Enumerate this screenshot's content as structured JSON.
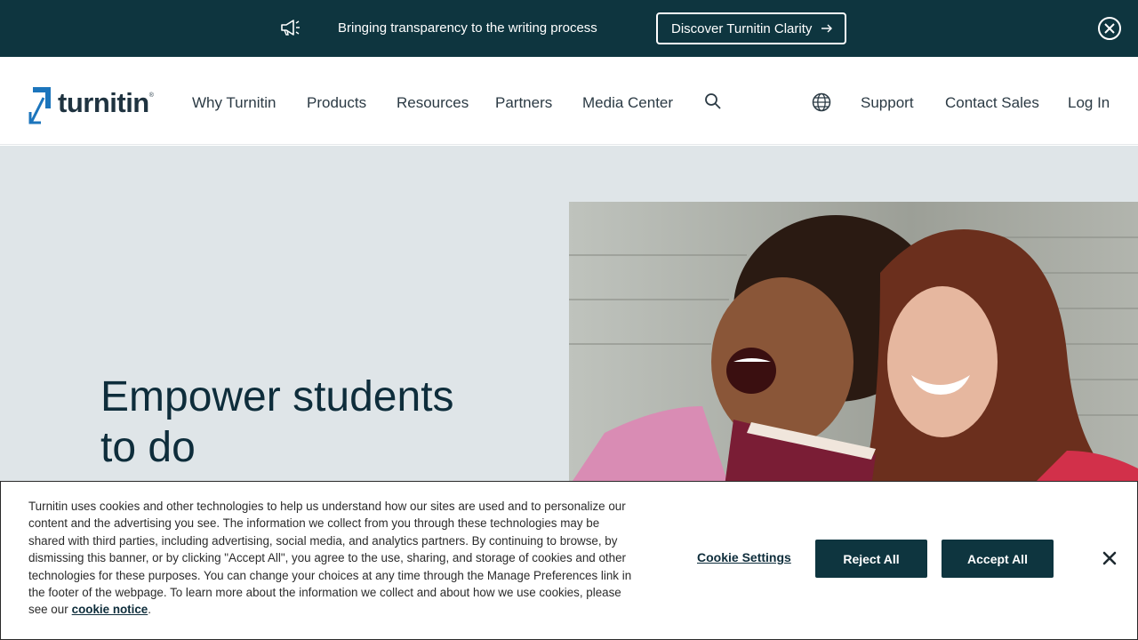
{
  "announcement": {
    "message": "Bringing transparency to the writing process",
    "cta_label": "Discover Turnitin Clarity",
    "icons": {
      "megaphone": "megaphone-icon",
      "arrow": "arrow-right-icon",
      "close": "close-circle-icon"
    }
  },
  "header": {
    "logo_text": "turnitin",
    "logo_mark": "®",
    "nav": [
      "Why Turnitin",
      "Products",
      "Resources",
      "Partners",
      "Media Center"
    ],
    "utility": [
      "Support",
      "Contact Sales",
      "Log In"
    ],
    "icons": {
      "search": "search-icon",
      "language": "globe-icon"
    }
  },
  "hero": {
    "title": "Empower students to do"
  },
  "cookie_banner": {
    "text": "Turnitin uses cookies and other technologies to help us understand how our sites are used and to personalize our content and the advertising you see. The information we collect from you through these technologies may be shared with third parties, including advertising, social media, and analytics partners. By continuing to browse, by dismissing this banner, or by clicking \"Accept All\", you agree to the use, sharing, and storage of cookies and other technologies for these purposes. You can change your choices at any time through the Manage Preferences link in the footer of the webpage. To learn more about the information we collect and about how we use cookies, please see our",
    "link_text": "cookie notice",
    "link_suffix": ".",
    "settings_label": "Cookie Settings",
    "reject_label": "Reject All",
    "accept_label": "Accept All"
  },
  "colors": {
    "brand_dark": "#0e353f",
    "logo_blue": "#1c75bc",
    "hero_bg": "#dfe5e8"
  }
}
